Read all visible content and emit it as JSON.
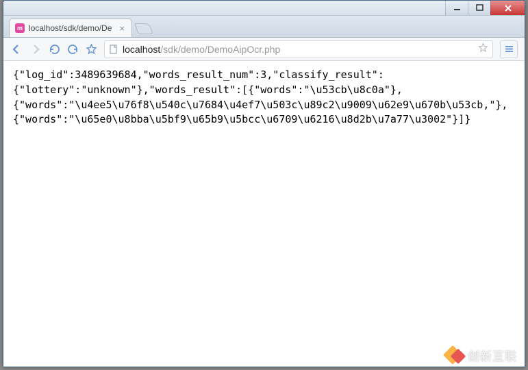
{
  "window": {
    "controls": {
      "min": "minimize",
      "max": "maximize",
      "close": "close"
    }
  },
  "tab": {
    "favicon_letter": "m",
    "title": "localhost/sdk/demo/De",
    "close": "×"
  },
  "toolbar": {
    "url_host": "localhost",
    "url_path": "/sdk/demo/DemoAipOcr.php"
  },
  "page": {
    "line1": "{\"log_id\":3489639684,\"words_result_num\":3,\"classify_result\":",
    "line2": "{\"lottery\":\"unknown\"},\"words_result\":[{\"words\":\"\\u53cb\\u8c0a\"},",
    "line3": "{\"words\":\"\\u4ee5\\u76f8\\u540c\\u7684\\u4ef7\\u503c\\u89c2\\u9009\\u62e9\\u670b\\u53cb,\"},",
    "line4": "{\"words\":\"\\u65e0\\u8bba\\u5bf9\\u65b9\\u5bcc\\u6709\\u6216\\u8d2b\\u7a77\\u3002\"}]}"
  },
  "watermark": {
    "text": "创新互联"
  }
}
